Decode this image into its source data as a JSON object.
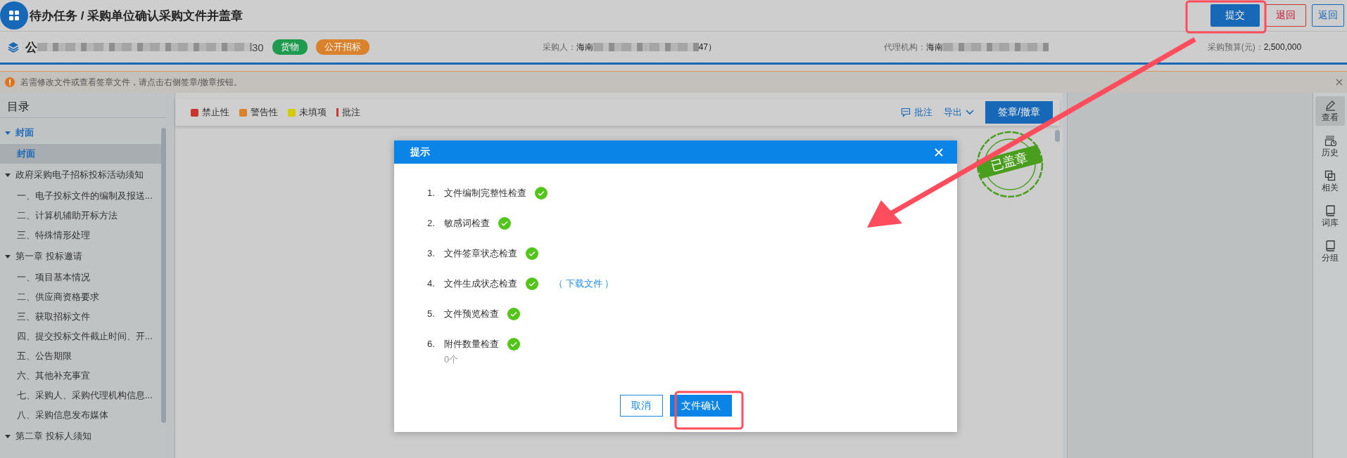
{
  "header": {
    "title": "待办任务 / 采购单位确认采购文件并盖章",
    "buttons": [
      {
        "label": "提交",
        "kind": "primary"
      },
      {
        "label": "退回",
        "kind": "danger"
      },
      {
        "label": "返回",
        "kind": "outline"
      }
    ]
  },
  "project": {
    "name_start": "公",
    "name_end": "30",
    "redacted": true,
    "tags": [
      {
        "label": "货物",
        "color": "#1f9b4f"
      },
      {
        "label": "公开招标",
        "color": "#d9822b"
      }
    ],
    "fields": [
      {
        "label": "采购人：",
        "value_start": "海南",
        "value_end": "47）",
        "redacted": true
      },
      {
        "label": "代理机构：",
        "value_start": "海南",
        "redacted": true
      },
      {
        "label": "采购预算(元)：",
        "value_start": "2,500,000",
        "redacted": false
      }
    ]
  },
  "notice": {
    "text": "若需修改文件或查看签章文件，请点击右侧签章/撤章按钮。"
  },
  "sidebar": {
    "title": "目录",
    "items": [
      {
        "label": "封面",
        "expanded": true,
        "active": true,
        "children": [
          {
            "label": "封面",
            "selected": true
          }
        ]
      },
      {
        "label": "政府采购电子招标投标活动须知",
        "expanded": true,
        "active": false,
        "children": [
          {
            "label": "一、电子投标文件的编制及报送...",
            "selected": false
          },
          {
            "label": "二、计算机辅助开标方法",
            "selected": false
          },
          {
            "label": "三、特殊情形处理",
            "selected": false
          }
        ]
      },
      {
        "label": "第一章 投标邀请",
        "expanded": true,
        "active": false,
        "children": [
          {
            "label": "一、项目基本情况",
            "selected": false
          },
          {
            "label": "二、供应商资格要求",
            "selected": false
          },
          {
            "label": "三、获取招标文件",
            "selected": false
          },
          {
            "label": "四、提交投标文件截止时间、开...",
            "selected": false
          },
          {
            "label": "五、公告期限",
            "selected": false
          },
          {
            "label": "六、其他补充事宜",
            "selected": false
          },
          {
            "label": "七、采购人、采购代理机构信息...",
            "selected": false
          },
          {
            "label": "八、采购信息发布媒体",
            "selected": false
          }
        ]
      },
      {
        "label": "第二章 投标人须知",
        "expanded": true,
        "active": false
      }
    ]
  },
  "toolbar": {
    "legend": [
      {
        "label": "禁止性",
        "kind": "square",
        "color": "#c8372d"
      },
      {
        "label": "警告性",
        "kind": "square",
        "color": "#d9822b"
      },
      {
        "label": "未填项",
        "kind": "square",
        "color": "#d4cc00"
      },
      {
        "label": "批注",
        "kind": "bar",
        "color": "#c8372d"
      }
    ],
    "actions": [
      {
        "label": "批注",
        "kind": "comment"
      },
      {
        "label": "导出",
        "kind": "dropdown"
      },
      {
        "label": "签章/撤章",
        "kind": "primary"
      }
    ]
  },
  "stamp": {
    "text": "已盖章"
  },
  "tools": [
    {
      "label": "查看",
      "kind": "pencil",
      "selected": true
    },
    {
      "label": "历史",
      "kind": "history",
      "selected": false
    },
    {
      "label": "相关",
      "kind": "copy",
      "selected": false
    },
    {
      "label": "词库",
      "kind": "book",
      "selected": false
    },
    {
      "label": "分组",
      "kind": "book",
      "selected": false
    }
  ],
  "dialog": {
    "title": "提示",
    "checks": [
      {
        "number": "1.",
        "label": "文件编制完整性检查",
        "passed": true
      },
      {
        "number": "2.",
        "label": "敏感词检查",
        "passed": true
      },
      {
        "number": "3.",
        "label": "文件签章状态检查",
        "passed": true
      },
      {
        "number": "4.",
        "label": "文件生成状态检查",
        "passed": true,
        "link": "（ 下载文件 ）"
      },
      {
        "number": "5.",
        "label": "文件预览检查",
        "passed": true
      },
      {
        "number": "6.",
        "label": "附件数量检查",
        "passed": true,
        "note": "0个"
      }
    ],
    "buttons": [
      {
        "label": "取消",
        "kind": "outline"
      },
      {
        "label": "文件确认",
        "kind": "primary"
      }
    ]
  }
}
